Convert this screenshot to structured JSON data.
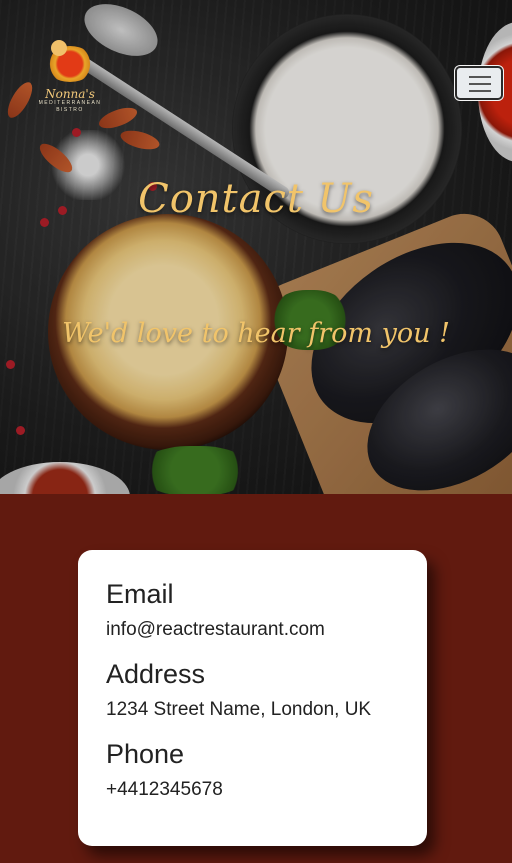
{
  "brand": {
    "logo_name": "Nonna's",
    "logo_tagline": "MEDITERRANEAN BISTRO"
  },
  "hero": {
    "title": "Contact Us",
    "subtitle": "We'd love to hear from you !"
  },
  "contact": {
    "email_heading": "Email",
    "email_value": "info@reactrestaurant.com",
    "address_heading": "Address",
    "address_value": "1234 Street Name, London, UK",
    "phone_heading": "Phone",
    "phone_value": "+4412345678"
  },
  "icons": {
    "menu": "hamburger-icon"
  },
  "colors": {
    "accent": "#f1c46a",
    "section_background": "#611a0f",
    "card_background": "#ffffff"
  }
}
